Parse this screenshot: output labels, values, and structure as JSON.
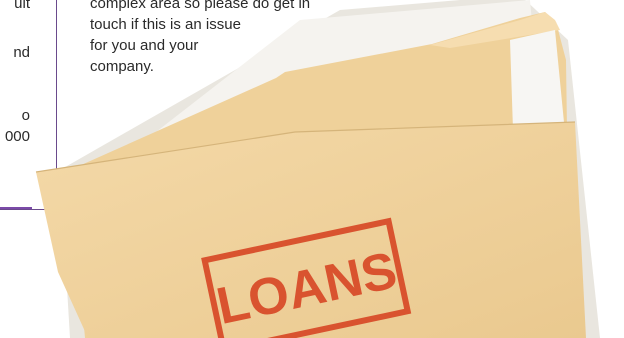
{
  "sidebar": {
    "lines": [
      "ult",
      "nd",
      "o",
      "000"
    ]
  },
  "article": {
    "lines": [
      "complex area so please do get in",
      "touch if this is an issue",
      "for you and your",
      "company."
    ]
  },
  "illustration": {
    "stamp_text": "LOANS",
    "stamp_color": "#d9532f",
    "folder_color": "#f1d29d"
  }
}
